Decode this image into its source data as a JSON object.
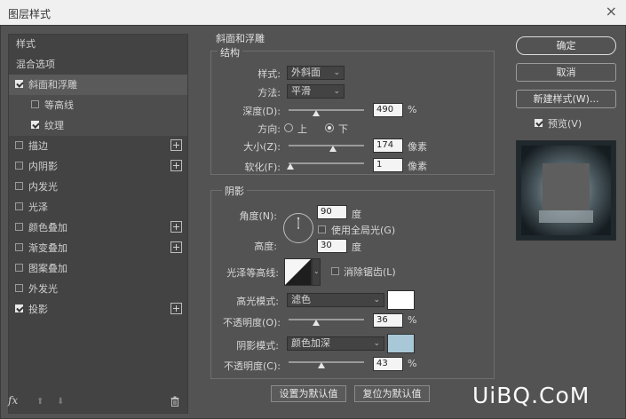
{
  "window": {
    "title": "图层样式",
    "close": "×"
  },
  "left_panel": {
    "items": [
      {
        "label": "样式",
        "checkbox": false,
        "checked": false,
        "plus": false
      },
      {
        "label": "混合选项",
        "checkbox": false,
        "checked": false,
        "plus": false
      },
      {
        "label": "斜面和浮雕",
        "checkbox": true,
        "checked": true,
        "plus": false,
        "selected": true
      },
      {
        "label": "等高线",
        "checkbox": true,
        "checked": false,
        "plus": false,
        "sub": true
      },
      {
        "label": "纹理",
        "checkbox": true,
        "checked": true,
        "plus": false,
        "sub": true
      },
      {
        "label": "描边",
        "checkbox": true,
        "checked": false,
        "plus": true
      },
      {
        "label": "内阴影",
        "checkbox": true,
        "checked": false,
        "plus": true
      },
      {
        "label": "内发光",
        "checkbox": true,
        "checked": false,
        "plus": false
      },
      {
        "label": "光泽",
        "checkbox": true,
        "checked": false,
        "plus": false
      },
      {
        "label": "颜色叠加",
        "checkbox": true,
        "checked": false,
        "plus": true
      },
      {
        "label": "渐变叠加",
        "checkbox": true,
        "checked": false,
        "plus": true
      },
      {
        "label": "图案叠加",
        "checkbox": true,
        "checked": false,
        "plus": false
      },
      {
        "label": "外发光",
        "checkbox": true,
        "checked": false,
        "plus": false
      },
      {
        "label": "投影",
        "checkbox": true,
        "checked": true,
        "plus": true
      }
    ],
    "footer": {
      "fx": "fx",
      "up": "⬆",
      "down": "⬇",
      "trash": "trash-icon"
    }
  },
  "bevel": {
    "section_title": "斜面和浮雕",
    "structure": {
      "title": "结构",
      "style_label": "样式:",
      "style_value": "外斜面",
      "technique_label": "方法:",
      "technique_value": "平滑",
      "depth_label": "深度(D):",
      "depth_value": "490",
      "depth_unit": "%",
      "depth_slider": 0.36,
      "direction_label": "方向:",
      "dir_up": "上",
      "dir_down": "下",
      "direction_selected": "下",
      "size_label": "大小(Z):",
      "size_value": "174",
      "size_unit": "像素",
      "size_slider": 0.59,
      "soften_label": "软化(F):",
      "soften_value": "1",
      "soften_unit": "像素",
      "soften_slider": 0.02
    },
    "shading": {
      "title": "阴影",
      "angle_label": "角度(N):",
      "angle_value": "90",
      "angle_unit": "度",
      "global_light_label": "使用全局光(G)",
      "global_light": false,
      "altitude_label": "高度:",
      "altitude_value": "30",
      "altitude_unit": "度",
      "gloss_label": "光泽等高线:",
      "antialias_label": "消除锯齿(L)",
      "antialias": false,
      "highlight_mode_label": "高光模式:",
      "highlight_mode": "滤色",
      "highlight_color": "#ffffff",
      "highlight_opacity_label": "不透明度(O):",
      "highlight_opacity": "36",
      "highlight_opacity_unit": "%",
      "highlight_slider": 0.36,
      "shadow_mode_label": "阴影模式:",
      "shadow_mode": "颜色加深",
      "shadow_color": "#a8c8d8",
      "shadow_opacity_label": "不透明度(C):",
      "shadow_opacity": "43",
      "shadow_opacity_unit": "%",
      "shadow_slider": 0.43
    },
    "make_default": "设置为默认值",
    "reset_default": "复位为默认值"
  },
  "right_panel": {
    "ok": "确定",
    "cancel": "取消",
    "new_style": "新建样式(W)...",
    "preview_label": "预览(V)",
    "preview_checked": true
  },
  "watermark": "UiBQ.CoM"
}
